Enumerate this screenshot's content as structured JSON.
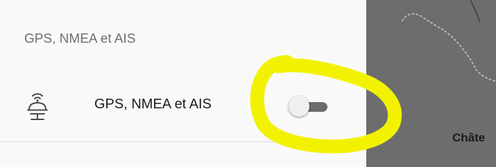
{
  "settings_panel": {
    "section_title": "GPS, NMEA et AIS",
    "row": {
      "icon": "gps-antenna-icon",
      "label": "GPS, NMEA et AIS",
      "toggle_state": "off"
    }
  },
  "map": {
    "place_label": "Châte"
  },
  "colors": {
    "panel_background": "#f9f9f9",
    "map_background": "#6d6d6d",
    "highlight_annotation": "#f2f200"
  }
}
